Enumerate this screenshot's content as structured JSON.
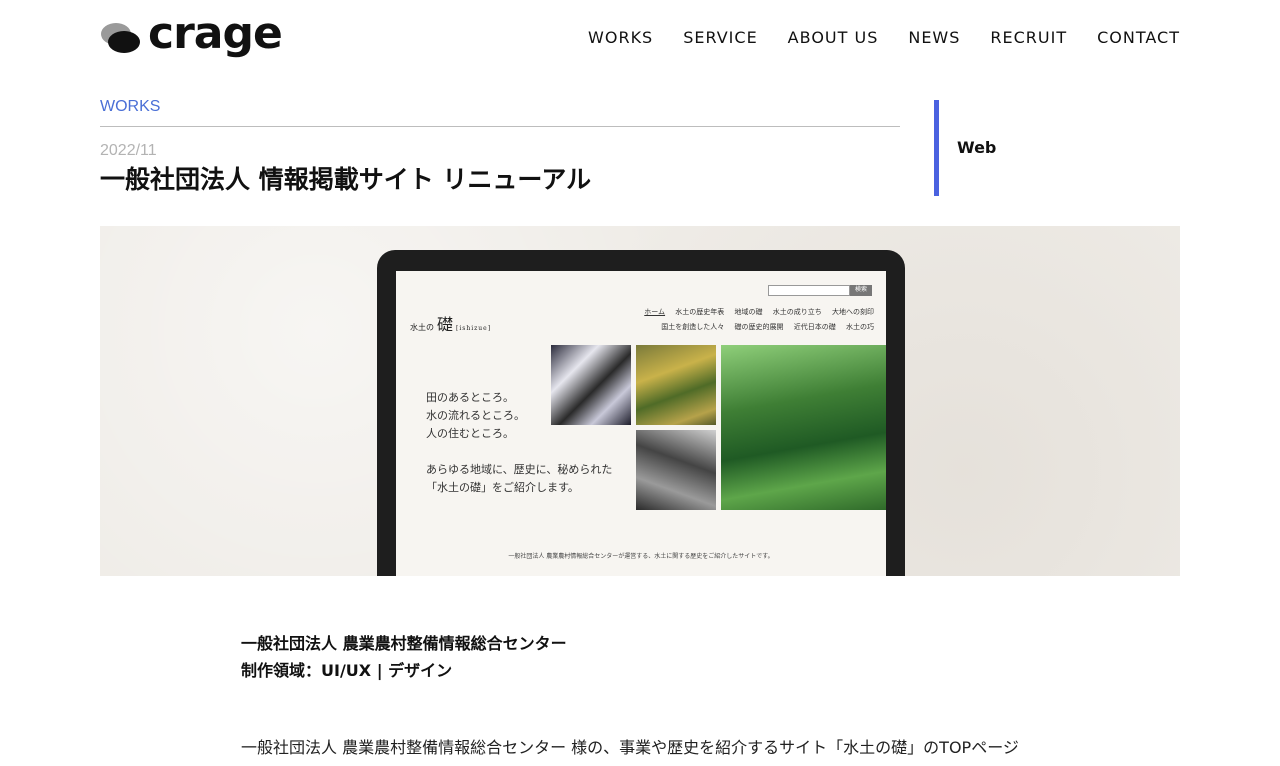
{
  "brand": {
    "name": "crage"
  },
  "nav": {
    "items": [
      {
        "label": "WORKS"
      },
      {
        "label": "SERVICE"
      },
      {
        "label": "ABOUT US"
      },
      {
        "label": "NEWS"
      },
      {
        "label": "RECRUIT"
      },
      {
        "label": "CONTACT"
      }
    ]
  },
  "article": {
    "category": "WORKS",
    "date": "2022/11",
    "title": "一般社団法人 情報掲載サイト リニューアル",
    "tag": "Web",
    "client": "一般社団法人 農業農村整備情報総合センター",
    "scope": "制作領域：UI/UX | デザイン",
    "description": "一般社団法人 農業農村整備情報総合センター 様の、事業や歴史を紹介するサイト「水土の礎」のTOPページ"
  },
  "hero_screen": {
    "site_logo_small": "水土の",
    "site_logo_big": "礎",
    "site_logo_roman": "[ishizue]",
    "search_button": "検索",
    "menu_row1": [
      "ホーム",
      "水土の歴史年表",
      "地域の礎",
      "水土の成り立ち",
      "大地への刻印"
    ],
    "menu_row2": [
      "国土を創造した人々",
      "礎の歴史的展開",
      "近代日本の礎",
      "水土の巧"
    ],
    "copy": "田のあるところ。\n水の流れるところ。\n人の住むところ。\n\nあらゆる地域に、歴史に、秘められた\n「水土の礎」をご紹介します。",
    "footer": "一般社団法人 農業農村情報総合センターが運営する、水土に関する歴史をご紹介したサイトです。"
  }
}
